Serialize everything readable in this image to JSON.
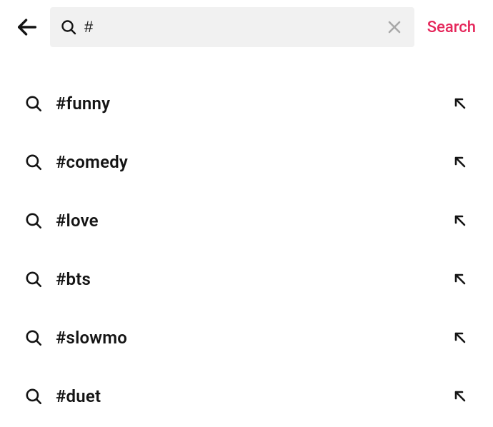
{
  "header": {
    "search_value": "#",
    "search_action_label": "Search"
  },
  "suggestions": [
    {
      "label": "#funny"
    },
    {
      "label": "#comedy"
    },
    {
      "label": "#love"
    },
    {
      "label": "#bts"
    },
    {
      "label": "#slowmo"
    },
    {
      "label": "#duet"
    }
  ]
}
